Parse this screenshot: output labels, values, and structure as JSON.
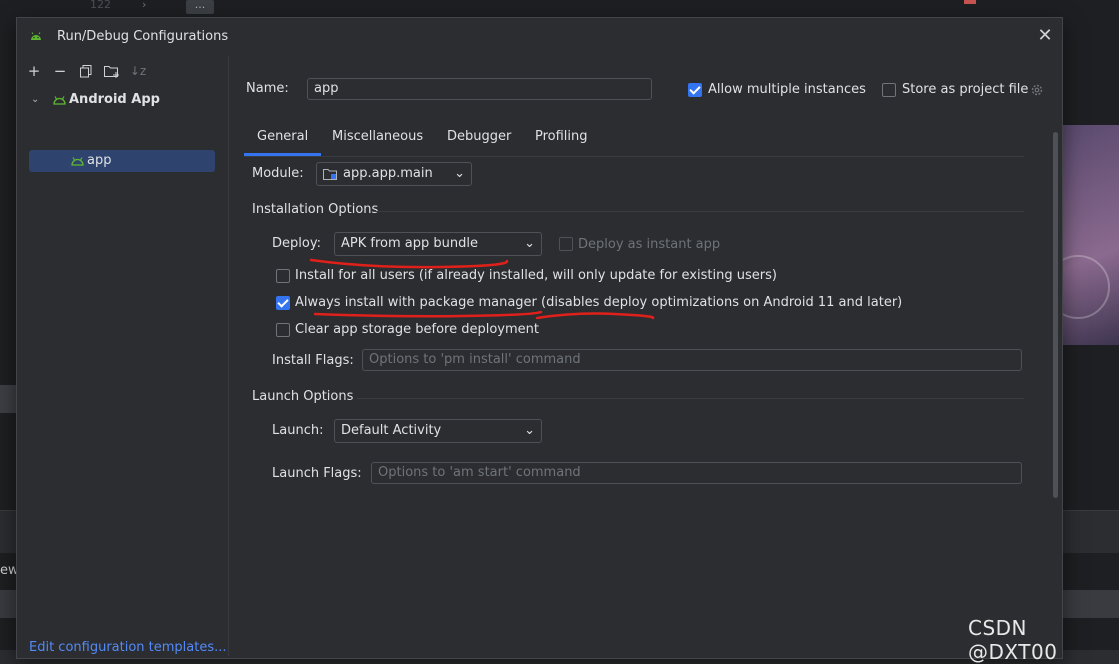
{
  "background": {
    "line_number": "122",
    "ellipsis": "...",
    "left_fragment": "ew"
  },
  "dialog": {
    "title": "Run/Debug Configurations",
    "close_icon": "close-icon"
  },
  "left": {
    "toolbar": [
      "add-icon",
      "remove-icon",
      "copy-icon",
      "new-folder-icon",
      "sort-icon"
    ],
    "tree": {
      "group_label": "Android App",
      "item_label": "app"
    },
    "edit_templates": "Edit configuration templates..."
  },
  "form": {
    "name_label": "Name:",
    "name_value": "app",
    "allow_multiple": {
      "label": "Allow multiple instances",
      "checked": true
    },
    "store_project": {
      "label": "Store as project file",
      "checked": false
    },
    "tabs": [
      "General",
      "Miscellaneous",
      "Debugger",
      "Profiling"
    ],
    "active_tab": "General",
    "module_label": "Module:",
    "module_value": "app.app.main",
    "installation_title": "Installation Options",
    "deploy_label": "Deploy:",
    "deploy_value": "APK from app bundle",
    "instant_app": {
      "label": "Deploy as instant app",
      "checked": false
    },
    "install_all_users": {
      "label": "Install for all users (if already installed, will only update for existing users)",
      "checked": false
    },
    "always_install": {
      "label": "Always install with package manager (disables deploy optimizations on Android 11 and later)",
      "checked": true
    },
    "clear_storage": {
      "label": "Clear app storage before deployment",
      "checked": false
    },
    "install_flags_label": "Install Flags:",
    "install_flags_placeholder": "Options to 'pm install' command",
    "launch_title": "Launch Options",
    "launch_label": "Launch:",
    "launch_value": "Default Activity",
    "launch_flags_label": "Launch Flags:",
    "launch_flags_placeholder": "Options to 'am start' command"
  },
  "watermark": "CSDN @DXT00",
  "colors": {
    "accent": "#3574f0",
    "android_green": "#5fb832",
    "annotation_red": "#e0201a",
    "link": "#548af7"
  }
}
